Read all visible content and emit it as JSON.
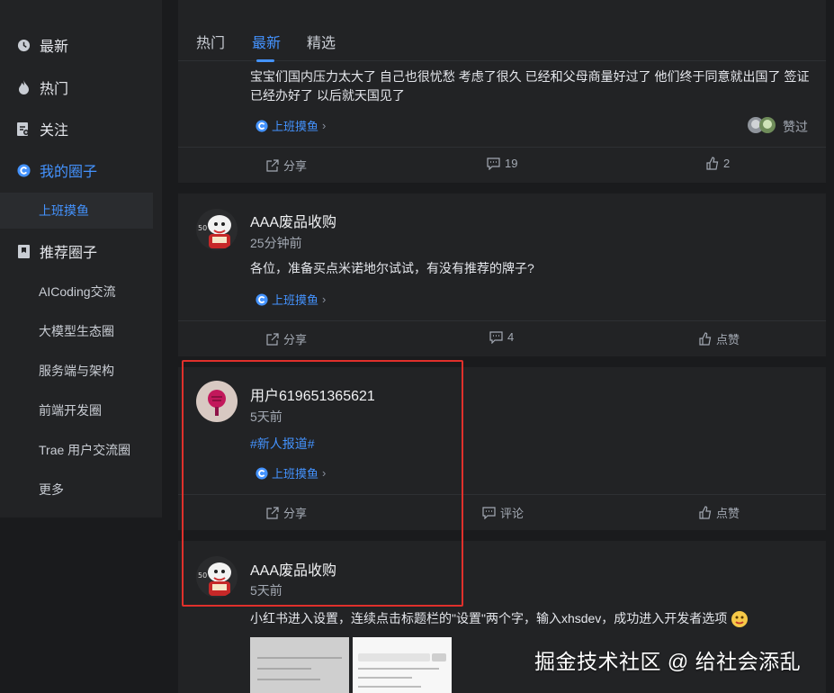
{
  "sidebar": {
    "items": [
      {
        "label": "最新",
        "icon": "clock-icon"
      },
      {
        "label": "热门",
        "icon": "flame-icon"
      },
      {
        "label": "关注",
        "icon": "follow-icon"
      },
      {
        "label": "我的圈子",
        "icon": "circle-icon"
      },
      {
        "label": "推荐圈子",
        "icon": "bookmark-icon"
      }
    ],
    "my_circle_sub": "上班摸鱼",
    "recommended": [
      "AICoding交流",
      "大模型生态圈",
      "服务端与架构",
      "前端开发圈",
      "Trae 用户交流圈",
      "更多"
    ]
  },
  "tabs": [
    "热门",
    "最新",
    "精选"
  ],
  "posts": [
    {
      "text_line1": "宝宝们国内压力太大了 自己也很忧愁 考虑了很久 已经和父母商量好过了 他们终于同意就出国了 签证",
      "text_line2": "已经办好了 以后就天国见了",
      "tag": "上班摸鱼",
      "tag_arrow": "›",
      "liked_label": "赞过",
      "share": "分享",
      "comments": "19",
      "likes": "2"
    },
    {
      "username": "AAA废品收购",
      "time": "25分钟前",
      "text": "各位，准备买点米诺地尔试试，有没有推荐的牌子?",
      "tag": "上班摸鱼",
      "tag_arrow": "›",
      "share": "分享",
      "comments": "4",
      "likes": "点赞"
    },
    {
      "username": "用户619651365621",
      "time": "5天前",
      "hashtag": "#新人报道#",
      "tag": "上班摸鱼",
      "tag_arrow": "›",
      "share": "分享",
      "comments": "评论",
      "likes": "点赞"
    },
    {
      "username": "AAA废品收购",
      "time": "5天前",
      "text": "小红书进入设置，连续点击标题栏的\"设置\"两个字，输入xhsdev，成功进入开发者选项"
    }
  ],
  "watermark": "掘金技术社区 @ 给社会添乱",
  "colors": {
    "accent": "#4493ff",
    "highlight": "#e0302b",
    "bg": "#1a1b1d",
    "panel": "#222325"
  }
}
